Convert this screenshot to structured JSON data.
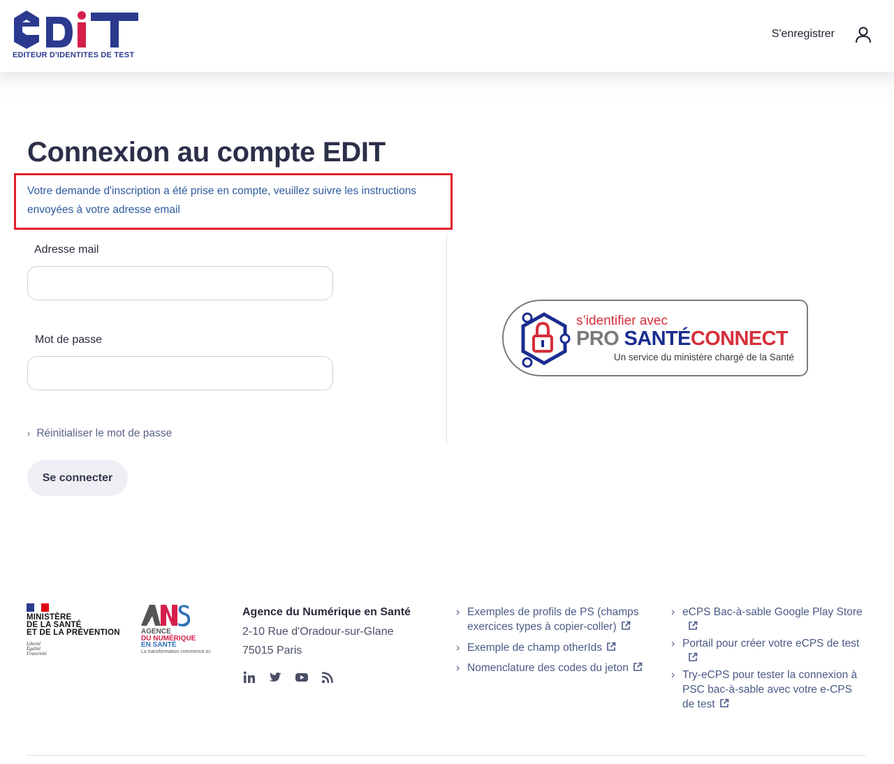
{
  "header": {
    "logo_text": "EDIT",
    "logo_subtitle": "EDITEUR D'IDENTITES DE TEST",
    "register_label": "S'enregistrer"
  },
  "main": {
    "title": "Connexion au compte EDIT",
    "notice": "Votre demande d'inscription a été prise en compte, veuillez suivre les instructions envoyées à votre adresse email",
    "email_label": "Adresse mail",
    "email_value": "",
    "password_label": "Mot de passe",
    "password_value": "",
    "reset_link": "Réinitialiser le mot de passe",
    "login_button": "Se connecter"
  },
  "psc": {
    "line1": "s’identifier avec",
    "pro": "PRO",
    "sante": "SANTÉ",
    "connect": "CONNECT",
    "line3": "Un service du ministère chargé de la Santé"
  },
  "footer": {
    "ministry_lines": [
      "MINISTÈRE",
      "DE LA SANTÉ",
      "ET DE LA PRÉVENTION"
    ],
    "ministry_motto": [
      "Liberté",
      "Égalité",
      "Fraternité"
    ],
    "ans_lines": [
      "AGENCE",
      "DU NUMÉRIQUE",
      "EN SANTÉ"
    ],
    "ans_tagline": "La transformation commence ici",
    "agency_name": "Agence du Numérique en Santé",
    "address_line1": "2-10 Rue d'Oradour-sur-Glane",
    "address_line2": "75015 Paris",
    "links_col1": [
      "Exemples de profils de PS (champs exercices types à copier-coller)",
      "Exemple de champ otherIds",
      "Nomenclature des codes du jeton"
    ],
    "links_col2": [
      "eCPS Bac-à-sable Google Play Store",
      "Portail pour créer votre eCPS de test",
      "Try-eCPS pour tester la connexion à PSC bac-à-sable avec votre e-CPS de test"
    ]
  },
  "colors": {
    "logo_blue": "#2b3a8f",
    "logo_red": "#d51f4b",
    "notice_border": "#e0202a",
    "notice_text": "#2e5a9e",
    "link_text": "#4b5a86"
  }
}
